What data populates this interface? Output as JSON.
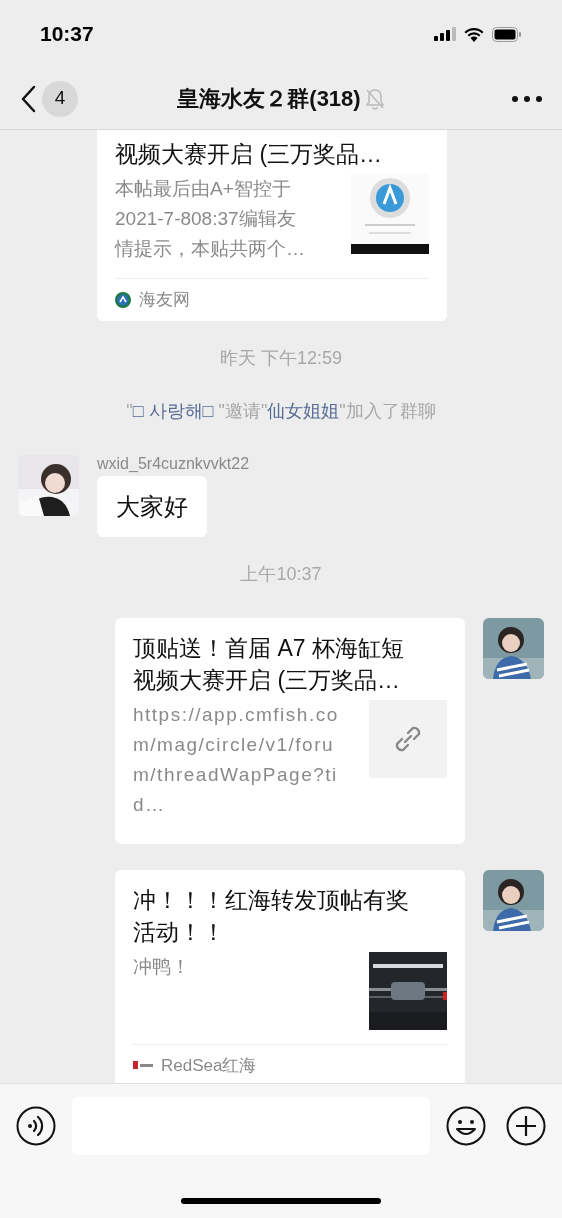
{
  "status_bar": {
    "time": "10:37"
  },
  "header": {
    "back_badge": "4",
    "title": "皇海水友２群(318)",
    "muted": true
  },
  "messages": [
    {
      "kind": "card_in",
      "title": "视频大赛开启 (三万奖品…",
      "description": "本帖最后由A+智控于2021-7-808:37编辑友情提示，本贴共两个…",
      "source": {
        "kind": "globe",
        "text": "海友网"
      }
    },
    {
      "kind": "time",
      "text": "昨天 下午12:59"
    },
    {
      "kind": "system",
      "parts": [
        {
          "kind": "plain",
          "text": "\""
        },
        {
          "kind": "name",
          "text": "□ 사랑해□"
        },
        {
          "kind": "plain",
          "text": " \"邀请\""
        },
        {
          "kind": "name",
          "text": "仙女姐姐"
        },
        {
          "kind": "plain",
          "text": "\"加入了群聊"
        }
      ]
    },
    {
      "kind": "text_in",
      "avatar": true,
      "sender": "wxid_5r4cuznkvvkt22",
      "text": "大家好"
    },
    {
      "kind": "time",
      "text": "上午10:37"
    },
    {
      "kind": "card_out",
      "avatar": true,
      "title": "顶贴送！首届 A7 杯海缸短视频大赛开启 (三万奖品…",
      "description": "https://app.cmfish.com/mag/circle/v1/forum/threadWapPage?tid…",
      "thumbnail": {
        "kind": "link"
      }
    },
    {
      "kind": "card_out",
      "avatar": true,
      "title": "冲！！！红海转发顶帖有奖活动！！",
      "description": "冲鸭！",
      "source": {
        "kind": "wordmark",
        "text": "RedSea红海"
      }
    }
  ]
}
